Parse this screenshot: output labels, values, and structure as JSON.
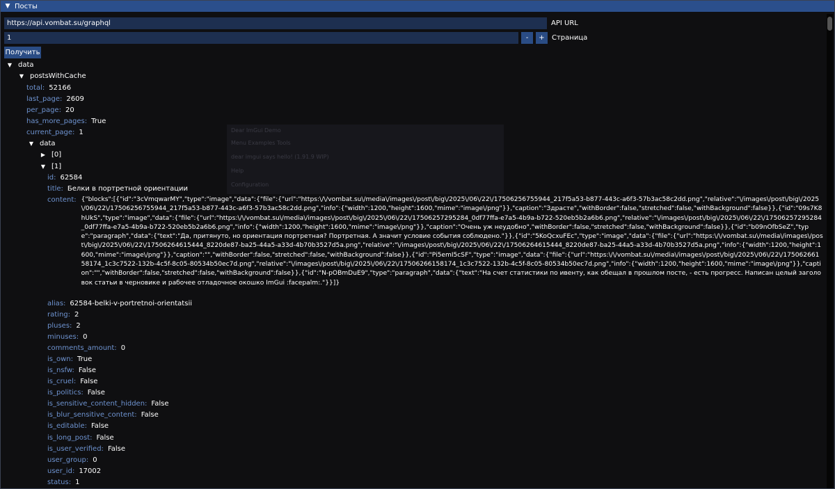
{
  "window": {
    "title": "Посты"
  },
  "api_url": {
    "value": "https://api.vombat.su/graphql",
    "label": "API URL"
  },
  "page": {
    "value": "1",
    "minus": "-",
    "plus": "+",
    "label": "Страница"
  },
  "fetch_button": "Получить",
  "ghost": {
    "title": "Dear ImGui Demo",
    "menu": "Menu   Examples   Tools",
    "line": "dear imgui says hello! (1.91.9 WIP)",
    "item1": "Help",
    "item2": "Configuration"
  },
  "tree": {
    "data": "data",
    "postsWithCache": "postsWithCache",
    "total": {
      "key": "total:",
      "val": "52166"
    },
    "last_page": {
      "key": "last_page:",
      "val": "2609"
    },
    "per_page": {
      "key": "per_page:",
      "val": "20"
    },
    "has_more_pages": {
      "key": "has_more_pages:",
      "val": "True"
    },
    "current_page": {
      "key": "current_page:",
      "val": "1"
    },
    "inner_data": "data",
    "item0": "[0]",
    "item1": "[1]",
    "id": {
      "key": "id:",
      "val": "62584"
    },
    "title": {
      "key": "title:",
      "val": "Белки в портретной ориентации"
    },
    "content": {
      "key": "content:",
      "val": "{\"blocks\":[{\"id\":\"3cVmqwarMY\",\"type\":\"image\",\"data\":{\"file\":{\"url\":\"https:\\/\\/vombat.su\\/media\\/images\\/post\\/big\\/2025\\/06\\/22\\/17506256755944_217f5a53-b877-443c-a6f3-57b3ac58c2dd.png\",\"relative\":\"\\/images\\/post\\/big\\/2025\\/06\\/22\\/17506256755944_217f5a53-b877-443c-a6f3-57b3ac58c2dd.png\",\"info\":{\"width\":1200,\"height\":1600,\"mime\":\"image\\/png\"}},\"caption\":\"Здрасте\",\"withBorder\":false,\"stretched\":false,\"withBackground\":false}},{\"id\":\"09s7K8hUkS\",\"type\":\"image\",\"data\":{\"file\":{\"url\":\"https:\\/\\/vombat.su\\/media\\/images\\/post\\/big\\/2025\\/06\\/22\\/17506257295284_0df77ffa-e7a5-4b9a-b722-520eb5b2a6b6.png\",\"relative\":\"\\/images\\/post\\/big\\/2025\\/06\\/22\\/17506257295284_0df77ffa-e7a5-4b9a-b722-520eb5b2a6b6.png\",\"info\":{\"width\":1200,\"height\":1600,\"mime\":\"image\\/png\"}},\"caption\":\"Очень уж неудобно\",\"withBorder\":false,\"stretched\":false,\"withBackground\":false}},{\"id\":\"b09nOfbSeZ\",\"type\":\"paragraph\",\"data\":{\"text\":\"Да, притянуто, но ориентация портретная? Портретная. А значит условие события соблюдено.\"}},{\"id\":\"5KoQcxuFEc\",\"type\":\"image\",\"data\":{\"file\":{\"url\":\"https:\\/\\/vombat.su\\/media\\/images\\/post\\/big\\/2025\\/06\\/22\\/17506264615444_8220de87-ba25-44a5-a33d-4b70b3527d5a.png\",\"relative\":\"\\/images\\/post\\/big\\/2025\\/06\\/22\\/17506264615444_8220de87-ba25-44a5-a33d-4b70b3527d5a.png\",\"info\":{\"width\":1200,\"height\":1600,\"mime\":\"image\\/png\"}},\"caption\":\"\",\"withBorder\":false,\"stretched\":false,\"withBackground\":false}},{\"id\":\"Pi5emI5cSF\",\"type\":\"image\",\"data\":{\"file\":{\"url\":\"https:\\/\\/vombat.su\\/media\\/images\\/post\\/big\\/2025\\/06\\/22\\/17506266158174_1c3c7522-132b-4c5f-8c05-80534b50ec7d.png\",\"relative\":\"\\/images\\/post\\/big\\/2025\\/06\\/22\\/17506266158174_1c3c7522-132b-4c5f-8c05-80534b50ec7d.png\",\"info\":{\"width\":1200,\"height\":1600,\"mime\":\"image\\/png\"}},\"caption\":\"\",\"withBorder\":false,\"stretched\":false,\"withBackground\":false}},{\"id\":\"N-pOBmDuE9\",\"type\":\"paragraph\",\"data\":{\"text\":\"На счет статистики по ивенту, как обещал в прошлом посте, - есть прогресс. Написан целый заголовок статьи в черновике и рабочее отладочное окошко ImGui :facepalm:.\"}}]}"
    },
    "alias": {
      "key": "alias:",
      "val": "62584-belki-v-portretnoi-orientatsii"
    },
    "rating": {
      "key": "rating:",
      "val": "2"
    },
    "pluses": {
      "key": "pluses:",
      "val": "2"
    },
    "minuses": {
      "key": "minuses:",
      "val": "0"
    },
    "comments_amount": {
      "key": "comments_amount:",
      "val": "0"
    },
    "is_own": {
      "key": "is_own:",
      "val": "True"
    },
    "is_nsfw": {
      "key": "is_nsfw:",
      "val": "False"
    },
    "is_cruel": {
      "key": "is_cruel:",
      "val": "False"
    },
    "is_politics": {
      "key": "is_politics:",
      "val": "False"
    },
    "is_sensitive_content_hidden": {
      "key": "is_sensitive_content_hidden:",
      "val": "False"
    },
    "is_blur_sensitive_content": {
      "key": "is_blur_sensitive_content:",
      "val": "False"
    },
    "is_editable": {
      "key": "is_editable:",
      "val": "False"
    },
    "is_long_post": {
      "key": "is_long_post:",
      "val": "False"
    },
    "is_user_verified": {
      "key": "is_user_verified:",
      "val": "False"
    },
    "user_group": {
      "key": "user_group:",
      "val": "0"
    },
    "user_id": {
      "key": "user_id:",
      "val": "17002"
    },
    "status": {
      "key": "status:",
      "val": "1"
    }
  },
  "colors": {
    "titlebar": "#2b4f8c",
    "field": "#1d2f50",
    "button": "#2a4c84",
    "key": "#6e93d0",
    "background": "#0f0f11"
  }
}
